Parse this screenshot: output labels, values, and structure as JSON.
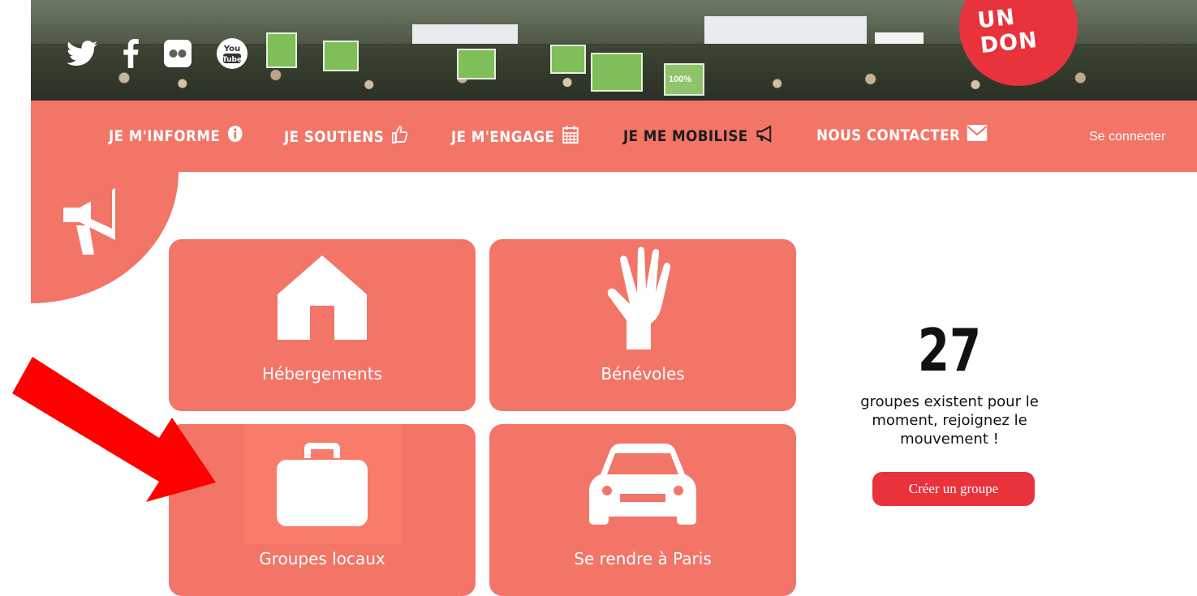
{
  "hero": {
    "don_badge": "UN DON",
    "social_icons": [
      "twitter-icon",
      "facebook-icon",
      "flickr-icon",
      "youtube-icon"
    ],
    "youtube_text_top": "You",
    "youtube_text_bottom": "Tube",
    "sign_text": "100%"
  },
  "nav": {
    "items": [
      {
        "label": "JE M'INFORME",
        "icon": "info-icon"
      },
      {
        "label": "JE SOUTIENS",
        "icon": "thumbs-up-icon"
      },
      {
        "label": "JE M'ENGAGE",
        "icon": "calendar-icon"
      },
      {
        "label": "JE ME MOBILISE",
        "icon": "megaphone-icon"
      },
      {
        "label": "NOUS CONTACTER",
        "icon": "envelope-icon"
      }
    ],
    "login": "Se connecter"
  },
  "tiles": [
    {
      "label": "Hébergements",
      "icon": "house-icon"
    },
    {
      "label": "Bénévoles",
      "icon": "hand-icon"
    },
    {
      "label": "Groupes locaux",
      "icon": "briefcase-icon"
    },
    {
      "label": "Se rendre à Paris",
      "icon": "car-icon"
    }
  ],
  "counter": {
    "value": "27",
    "message_line1": "groupes existent pour le",
    "message_line2": "moment, rejoignez le",
    "message_line3": "mouvement !",
    "button": "Créer un groupe"
  },
  "colors": {
    "accent": "#f27568",
    "button_red": "#e8323c",
    "arrow_red": "#ff0000"
  }
}
